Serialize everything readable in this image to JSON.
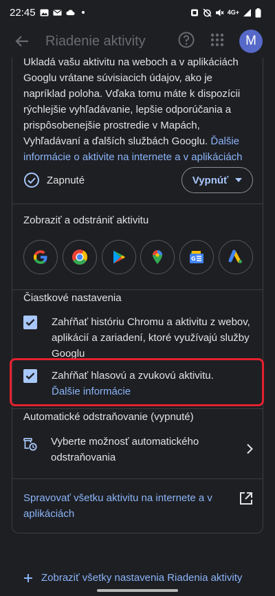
{
  "status_bar": {
    "time": "22:45",
    "network": "4G+"
  },
  "app_bar": {
    "title": "Riadenie aktivity",
    "avatar_letter": "M"
  },
  "description": {
    "text": "Ukladá vašu aktivitu na weboch a v aplikáciách Googlu vrátane súvisiacich údajov, ako je napríklad poloha. Vďaka tomu máte k dispozícii rýchlejšie vyhľadávanie, lepšie odporúčania a prispôsobenejšie prostredie v Mapách, Vyhľadávaní a ďalších službách Googlu.",
    "link": "Ďalšie informácie o aktivite na internete a v aplikáciách"
  },
  "activity_status": {
    "label": "Zapnuté",
    "turn_off_label": "Vypnúť"
  },
  "view_delete": {
    "title": "Zobraziť a odstrániť aktivitu",
    "apps": [
      "google-icon",
      "chrome-icon",
      "play-store-icon",
      "maps-icon",
      "news-icon",
      "ads-icon"
    ]
  },
  "sub_settings": {
    "title": "Čiastkové nastavenia",
    "chrome_history": "Zahŕňať históriu Chromu a aktivitu z webov, aplikácií a zariadení, ktoré využívajú služby Googlu",
    "voice_audio": "Zahŕňať hlasovú a zvukovú aktivitu.",
    "voice_audio_link": "Ďalšie informácie"
  },
  "auto_delete": {
    "title": "Automatické odstraňovanie (vypnuté)",
    "option": "Vyberte možnosť automatického odstraňovania"
  },
  "manage": {
    "label": "Spravovať všetku aktivitu na internete a v aplikáciách"
  },
  "bottom": {
    "label": "Zobraziť všetky nastavenia Riadenia aktivity"
  },
  "colors": {
    "background": "#1e1f23",
    "link": "#8ab4f8",
    "checkbox": "#a8c7fa",
    "highlight": "#e5202e"
  }
}
